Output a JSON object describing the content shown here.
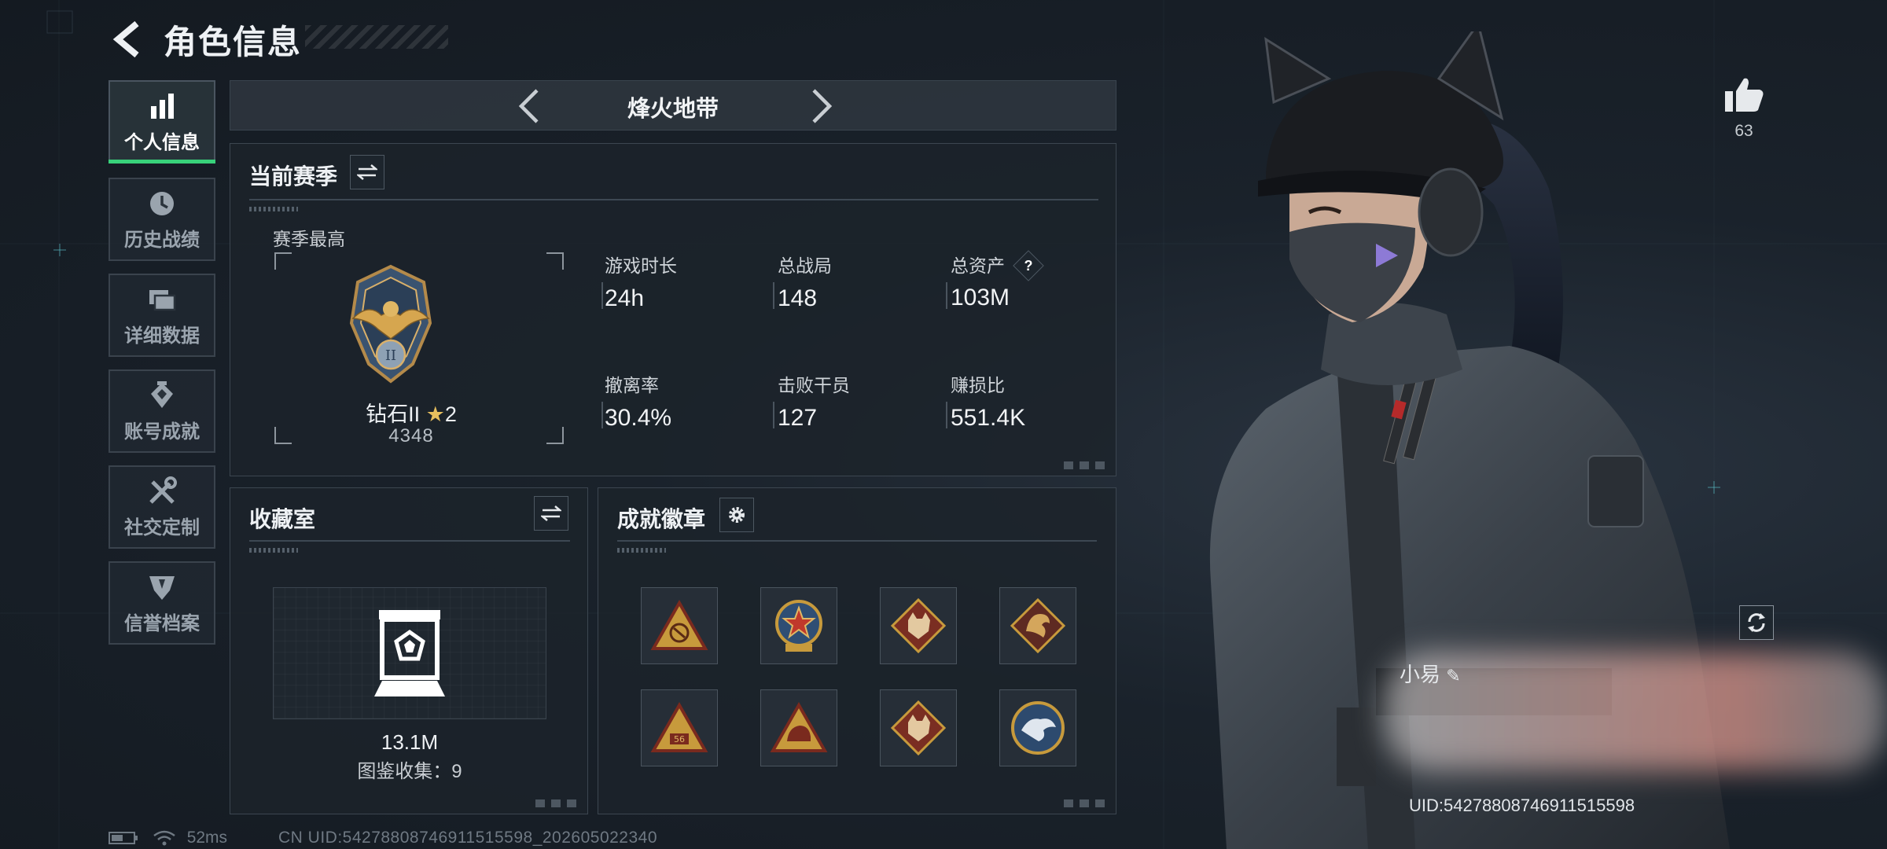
{
  "header": {
    "title": "角色信息"
  },
  "sidebar": {
    "items": [
      {
        "label": "个人信息",
        "icon": "bar-chart-icon",
        "active": true
      },
      {
        "label": "历史战绩",
        "icon": "clock-icon",
        "active": false
      },
      {
        "label": "详细数据",
        "icon": "cards-icon",
        "active": false
      },
      {
        "label": "账号成就",
        "icon": "medal-icon",
        "active": false
      },
      {
        "label": "社交定制",
        "icon": "tools-icon",
        "active": false
      },
      {
        "label": "信誉档案",
        "icon": "shield-icon",
        "active": false
      }
    ]
  },
  "season": {
    "name": "烽火地带"
  },
  "current_season": {
    "title": "当前赛季",
    "highest_label": "赛季最高",
    "rank_name": "钻石II",
    "rank_stars": "2",
    "rank_score": "4348",
    "stats": [
      {
        "label": "游戏时长",
        "value": "24h"
      },
      {
        "label": "总战局",
        "value": "148"
      },
      {
        "label": "总资产",
        "value": "103M",
        "has_help": true
      },
      {
        "label": "撤离率",
        "value": "30.4%"
      },
      {
        "label": "击败干员",
        "value": "127"
      },
      {
        "label": "赚损比",
        "value": "551.4K"
      }
    ],
    "help_symbol": "?"
  },
  "collection": {
    "title": "收藏室",
    "value": "13.1M",
    "progress_label": "图鉴收集：9"
  },
  "achievements": {
    "title": "成就徽章",
    "badges": [
      {
        "icon": "triangle-badge-icon"
      },
      {
        "icon": "star-shield-badge-icon"
      },
      {
        "icon": "wolf-diamond-badge-icon"
      },
      {
        "icon": "dragon-diamond-badge-icon"
      },
      {
        "icon": "triangle-56-badge-icon"
      },
      {
        "icon": "helmet-triangle-badge-icon"
      },
      {
        "icon": "wolf-diamond-badge-icon"
      },
      {
        "icon": "eagle-round-badge-icon"
      }
    ]
  },
  "likes": {
    "count": "63"
  },
  "status": {
    "ping": "52ms"
  },
  "footer": {
    "uid": "CN UID:54278808746911515598_202605022340"
  },
  "character": {
    "name_fragment": "小易",
    "uid_text": "UID:54278808746911515598"
  },
  "colors": {
    "accent_green": "#38d17a",
    "panel_border": "#3c4650",
    "background": "#1a222b"
  }
}
